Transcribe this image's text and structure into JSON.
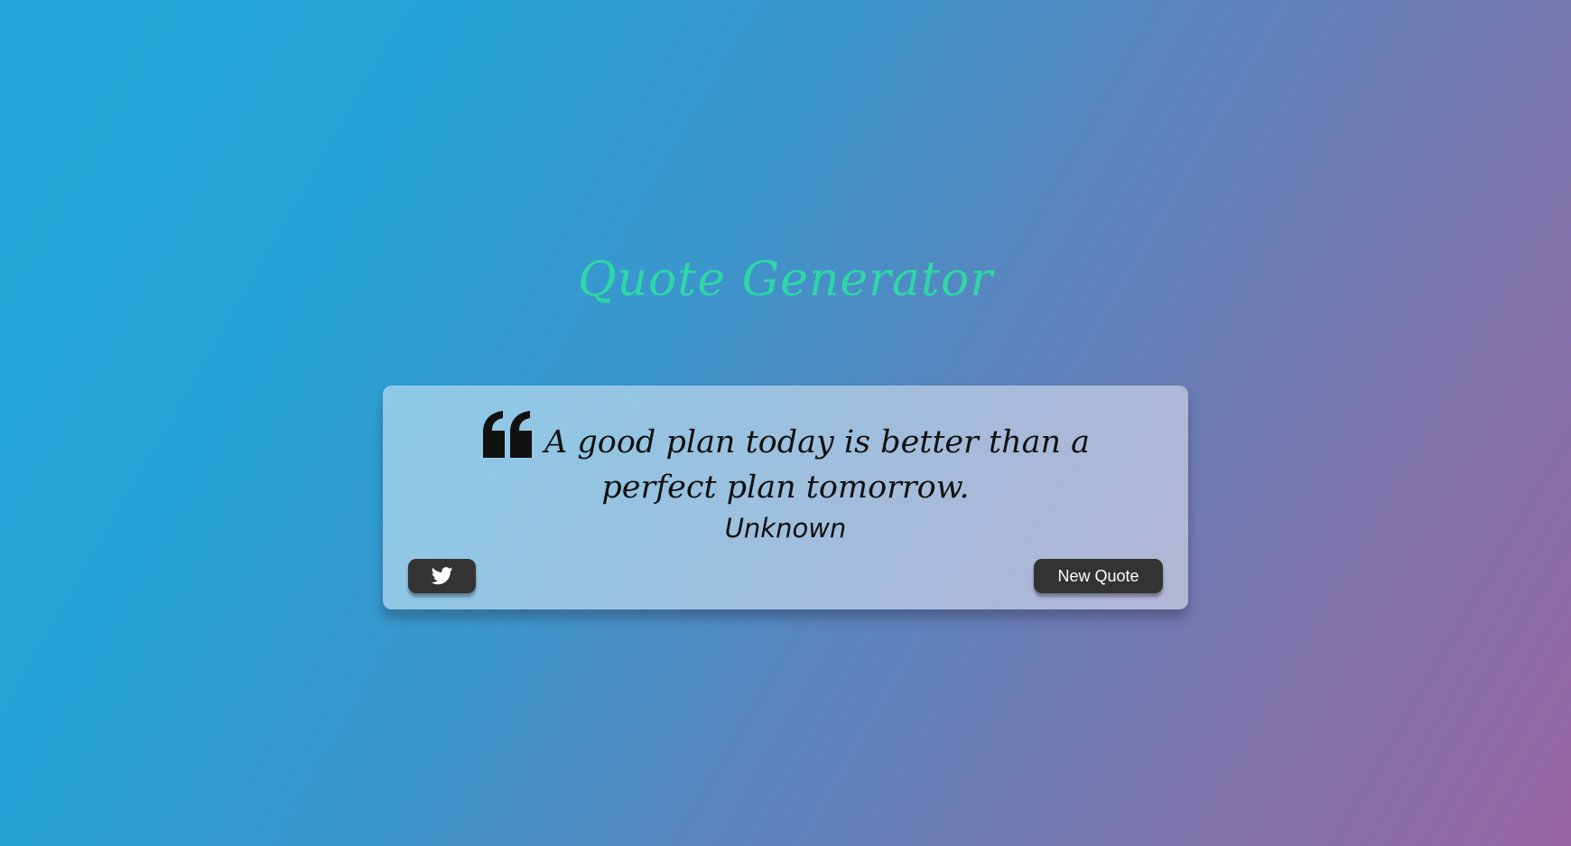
{
  "header": {
    "title": "Quote Generator"
  },
  "quote": {
    "text": "A good plan today is better than a perfect plan tomorrow.",
    "author": "Unknown"
  },
  "actions": {
    "twitter_icon": "twitter-bird",
    "new_quote_label": "New Quote"
  },
  "colors": {
    "title": "#2fd6a8",
    "button_bg": "#333333",
    "gradient_start": "#22a7d8",
    "gradient_end": "#9866a4"
  }
}
